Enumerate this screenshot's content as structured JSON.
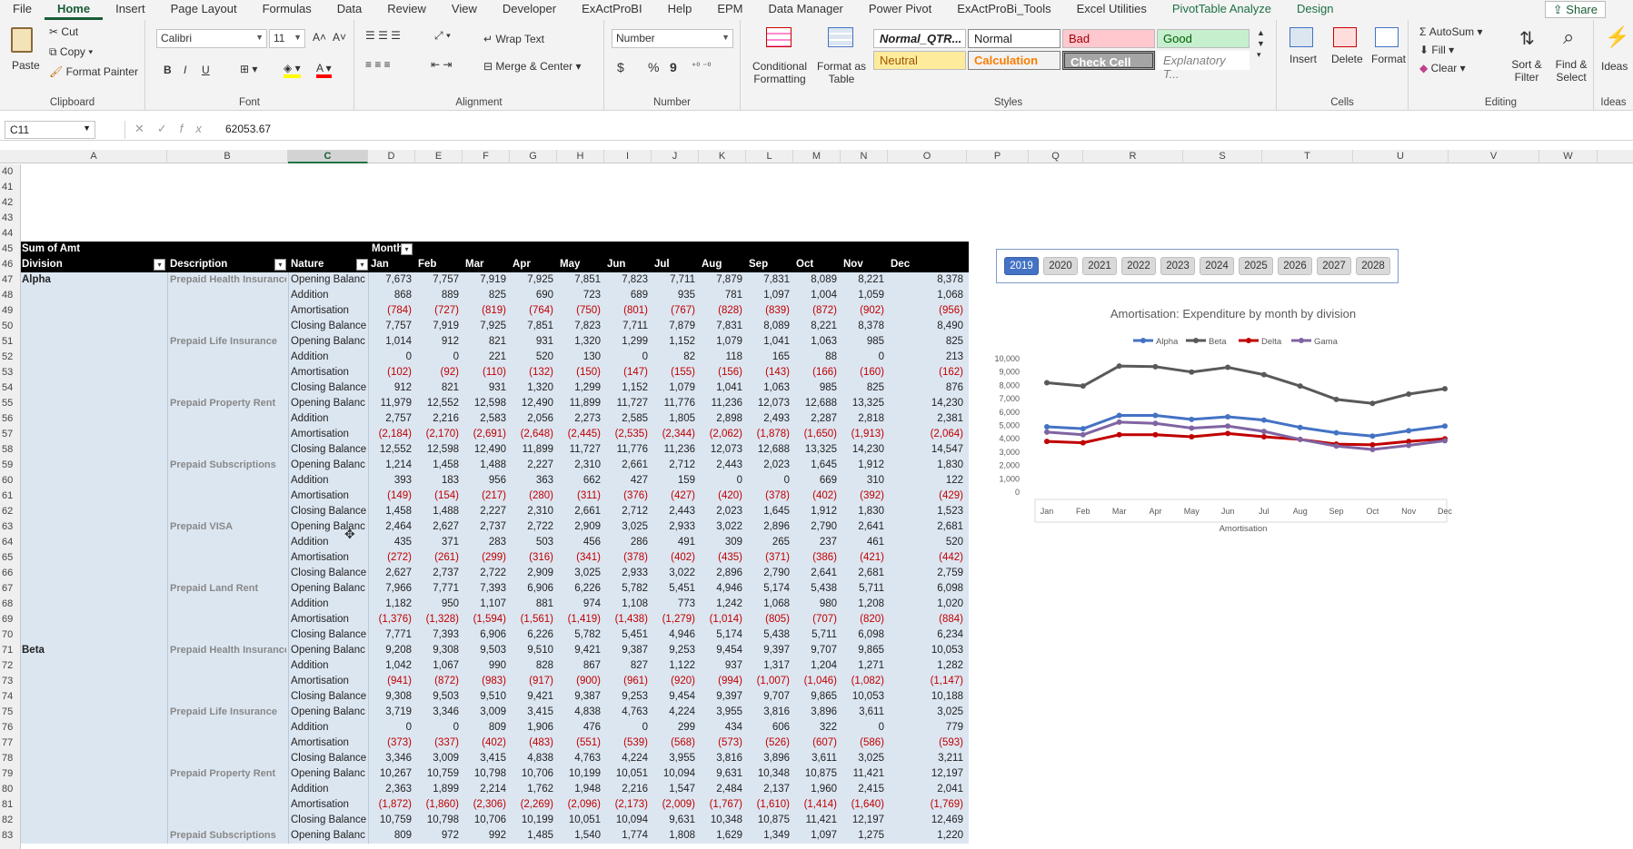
{
  "menu": {
    "items": [
      "File",
      "Home",
      "Insert",
      "Page Layout",
      "Formulas",
      "Data",
      "Review",
      "View",
      "Developer",
      "ExActProBI",
      "Help",
      "EPM",
      "Data Manager",
      "Power Pivot",
      "ExActProBi_Tools",
      "Excel Utilities",
      "PivotTable Analyze",
      "Design"
    ],
    "share": "Share"
  },
  "ribbon": {
    "clipboard": {
      "paste": "Paste",
      "cut": "Cut",
      "copy": "Copy",
      "format_painter": "Format Painter",
      "label": "Clipboard"
    },
    "font": {
      "name": "Calibri",
      "size": "11",
      "label": "Font",
      "bold": "B",
      "italic": "I",
      "underline": "U"
    },
    "alignment": {
      "wrap": "Wrap Text",
      "merge": "Merge & Center",
      "label": "Alignment"
    },
    "number": {
      "format": "Number",
      "label": "Number",
      "currency": "$",
      "percent": "%",
      "comma": "9"
    },
    "styles": {
      "cond": "Conditional Formatting",
      "table": "Format as Table",
      "label": "Styles",
      "normal_qtr": "Normal_QTR...",
      "normal": "Normal",
      "bad": "Bad",
      "good": "Good",
      "neutral": "Neutral",
      "calculation": "Calculation",
      "check_cell": "Check Cell",
      "explanatory": "Explanatory T..."
    },
    "cells": {
      "insert": "Insert",
      "delete": "Delete",
      "format": "Format",
      "label": "Cells"
    },
    "editing": {
      "autosum": "AutoSum",
      "fill": "Fill",
      "clear": "Clear",
      "sort": "Sort & Filter",
      "find": "Find & Select",
      "label": "Editing"
    },
    "ideas": {
      "ideas": "Ideas",
      "label": "Ideas"
    }
  },
  "formula_bar": {
    "name_box": "C11",
    "value": "62053.67",
    "fx": "fx"
  },
  "columns": [
    "A",
    "B",
    "C",
    "D",
    "E",
    "F",
    "G",
    "H",
    "I",
    "J",
    "K",
    "L",
    "M",
    "N",
    "O",
    "P",
    "Q",
    "R",
    "S",
    "T",
    "U",
    "V",
    "W"
  ],
  "selected_column": "C",
  "row_numbers": [
    40,
    41,
    42,
    43,
    44,
    45,
    46,
    47,
    48,
    49,
    50,
    51,
    52,
    53,
    54,
    55,
    56,
    57,
    58,
    59,
    60,
    61,
    62,
    63,
    64,
    65,
    66,
    67,
    68,
    69,
    70,
    71,
    72,
    73,
    74,
    75,
    76,
    77,
    78,
    79,
    80,
    81,
    82,
    83
  ],
  "pivot": {
    "header1": {
      "sum": "Sum of Amt",
      "month": "Month"
    },
    "header2": {
      "division": "Division",
      "description": "Description",
      "nature": "Nature",
      "months": [
        "Jan",
        "Feb",
        "Mar",
        "Apr",
        "May",
        "Jun",
        "Jul",
        "Aug",
        "Sep",
        "Oct",
        "Nov",
        "Dec"
      ]
    },
    "rows": [
      {
        "div": "Alpha",
        "desc": "Prepaid Health Insurance",
        "nat": "Opening Balanc",
        "v": [
          "7,673",
          "7,757",
          "7,919",
          "7,925",
          "7,851",
          "7,823",
          "7,711",
          "7,879",
          "7,831",
          "8,089",
          "8,221",
          "8,378"
        ]
      },
      {
        "div": "",
        "desc": "",
        "nat": "Addition",
        "v": [
          "868",
          "889",
          "825",
          "690",
          "723",
          "689",
          "935",
          "781",
          "1,097",
          "1,004",
          "1,059",
          "1,068"
        ]
      },
      {
        "div": "",
        "desc": "",
        "nat": "Amortisation",
        "v": [
          "(784)",
          "(727)",
          "(819)",
          "(764)",
          "(750)",
          "(801)",
          "(767)",
          "(828)",
          "(839)",
          "(872)",
          "(902)",
          "(956)"
        ]
      },
      {
        "div": "",
        "desc": "",
        "nat": "Closing Balance",
        "v": [
          "7,757",
          "7,919",
          "7,925",
          "7,851",
          "7,823",
          "7,711",
          "7,879",
          "7,831",
          "8,089",
          "8,221",
          "8,378",
          "8,490"
        ]
      },
      {
        "div": "",
        "desc": "Prepaid Life Insurance",
        "nat": "Opening Balanc",
        "v": [
          "1,014",
          "912",
          "821",
          "931",
          "1,320",
          "1,299",
          "1,152",
          "1,079",
          "1,041",
          "1,063",
          "985",
          "825"
        ]
      },
      {
        "div": "",
        "desc": "",
        "nat": "Addition",
        "v": [
          "0",
          "0",
          "221",
          "520",
          "130",
          "0",
          "82",
          "118",
          "165",
          "88",
          "0",
          "213"
        ]
      },
      {
        "div": "",
        "desc": "",
        "nat": "Amortisation",
        "v": [
          "(102)",
          "(92)",
          "(110)",
          "(132)",
          "(150)",
          "(147)",
          "(155)",
          "(156)",
          "(143)",
          "(166)",
          "(160)",
          "(162)"
        ]
      },
      {
        "div": "",
        "desc": "",
        "nat": "Closing Balance",
        "v": [
          "912",
          "821",
          "931",
          "1,320",
          "1,299",
          "1,152",
          "1,079",
          "1,041",
          "1,063",
          "985",
          "825",
          "876"
        ]
      },
      {
        "div": "",
        "desc": "Prepaid Property Rent",
        "nat": "Opening Balanc",
        "v": [
          "11,979",
          "12,552",
          "12,598",
          "12,490",
          "11,899",
          "11,727",
          "11,776",
          "11,236",
          "12,073",
          "12,688",
          "13,325",
          "14,230"
        ]
      },
      {
        "div": "",
        "desc": "",
        "nat": "Addition",
        "v": [
          "2,757",
          "2,216",
          "2,583",
          "2,056",
          "2,273",
          "2,585",
          "1,805",
          "2,898",
          "2,493",
          "2,287",
          "2,818",
          "2,381"
        ]
      },
      {
        "div": "",
        "desc": "",
        "nat": "Amortisation",
        "v": [
          "(2,184)",
          "(2,170)",
          "(2,691)",
          "(2,648)",
          "(2,445)",
          "(2,535)",
          "(2,344)",
          "(2,062)",
          "(1,878)",
          "(1,650)",
          "(1,913)",
          "(2,064)"
        ]
      },
      {
        "div": "",
        "desc": "",
        "nat": "Closing Balance",
        "v": [
          "12,552",
          "12,598",
          "12,490",
          "11,899",
          "11,727",
          "11,776",
          "11,236",
          "12,073",
          "12,688",
          "13,325",
          "14,230",
          "14,547"
        ]
      },
      {
        "div": "",
        "desc": "Prepaid Subscriptions",
        "nat": "Opening Balanc",
        "v": [
          "1,214",
          "1,458",
          "1,488",
          "2,227",
          "2,310",
          "2,661",
          "2,712",
          "2,443",
          "2,023",
          "1,645",
          "1,912",
          "1,830"
        ]
      },
      {
        "div": "",
        "desc": "",
        "nat": "Addition",
        "v": [
          "393",
          "183",
          "956",
          "363",
          "662",
          "427",
          "159",
          "0",
          "0",
          "669",
          "310",
          "122"
        ]
      },
      {
        "div": "",
        "desc": "",
        "nat": "Amortisation",
        "v": [
          "(149)",
          "(154)",
          "(217)",
          "(280)",
          "(311)",
          "(376)",
          "(427)",
          "(420)",
          "(378)",
          "(402)",
          "(392)",
          "(429)"
        ]
      },
      {
        "div": "",
        "desc": "",
        "nat": "Closing Balance",
        "v": [
          "1,458",
          "1,488",
          "2,227",
          "2,310",
          "2,661",
          "2,712",
          "2,443",
          "2,023",
          "1,645",
          "1,912",
          "1,830",
          "1,523"
        ]
      },
      {
        "div": "",
        "desc": "Prepaid VISA",
        "nat": "Opening Balanc",
        "v": [
          "2,464",
          "2,627",
          "2,737",
          "2,722",
          "2,909",
          "3,025",
          "2,933",
          "3,022",
          "2,896",
          "2,790",
          "2,641",
          "2,681"
        ]
      },
      {
        "div": "",
        "desc": "",
        "nat": "Addition",
        "v": [
          "435",
          "371",
          "283",
          "503",
          "456",
          "286",
          "491",
          "309",
          "265",
          "237",
          "461",
          "520"
        ]
      },
      {
        "div": "",
        "desc": "",
        "nat": "Amortisation",
        "v": [
          "(272)",
          "(261)",
          "(299)",
          "(316)",
          "(341)",
          "(378)",
          "(402)",
          "(435)",
          "(371)",
          "(386)",
          "(421)",
          "(442)"
        ]
      },
      {
        "div": "",
        "desc": "",
        "nat": "Closing Balance",
        "v": [
          "2,627",
          "2,737",
          "2,722",
          "2,909",
          "3,025",
          "2,933",
          "3,022",
          "2,896",
          "2,790",
          "2,641",
          "2,681",
          "2,759"
        ]
      },
      {
        "div": "",
        "desc": "Prepaid Land Rent",
        "nat": "Opening Balanc",
        "v": [
          "7,966",
          "7,771",
          "7,393",
          "6,906",
          "6,226",
          "5,782",
          "5,451",
          "4,946",
          "5,174",
          "5,438",
          "5,711",
          "6,098"
        ]
      },
      {
        "div": "",
        "desc": "",
        "nat": "Addition",
        "v": [
          "1,182",
          "950",
          "1,107",
          "881",
          "974",
          "1,108",
          "773",
          "1,242",
          "1,068",
          "980",
          "1,208",
          "1,020"
        ]
      },
      {
        "div": "",
        "desc": "",
        "nat": "Amortisation",
        "v": [
          "(1,376)",
          "(1,328)",
          "(1,594)",
          "(1,561)",
          "(1,419)",
          "(1,438)",
          "(1,279)",
          "(1,014)",
          "(805)",
          "(707)",
          "(820)",
          "(884)"
        ]
      },
      {
        "div": "",
        "desc": "",
        "nat": "Closing Balance",
        "v": [
          "7,771",
          "7,393",
          "6,906",
          "6,226",
          "5,782",
          "5,451",
          "4,946",
          "5,174",
          "5,438",
          "5,711",
          "6,098",
          "6,234"
        ]
      },
      {
        "div": "Beta",
        "desc": "Prepaid Health Insurance",
        "nat": "Opening Balanc",
        "v": [
          "9,208",
          "9,308",
          "9,503",
          "9,510",
          "9,421",
          "9,387",
          "9,253",
          "9,454",
          "9,397",
          "9,707",
          "9,865",
          "10,053"
        ]
      },
      {
        "div": "",
        "desc": "",
        "nat": "Addition",
        "v": [
          "1,042",
          "1,067",
          "990",
          "828",
          "867",
          "827",
          "1,122",
          "937",
          "1,317",
          "1,204",
          "1,271",
          "1,282"
        ]
      },
      {
        "div": "",
        "desc": "",
        "nat": "Amortisation",
        "v": [
          "(941)",
          "(872)",
          "(983)",
          "(917)",
          "(900)",
          "(961)",
          "(920)",
          "(994)",
          "(1,007)",
          "(1,046)",
          "(1,082)",
          "(1,147)"
        ]
      },
      {
        "div": "",
        "desc": "",
        "nat": "Closing Balance",
        "v": [
          "9,308",
          "9,503",
          "9,510",
          "9,421",
          "9,387",
          "9,253",
          "9,454",
          "9,397",
          "9,707",
          "9,865",
          "10,053",
          "10,188"
        ]
      },
      {
        "div": "",
        "desc": "Prepaid Life Insurance",
        "nat": "Opening Balanc",
        "v": [
          "3,719",
          "3,346",
          "3,009",
          "3,415",
          "4,838",
          "4,763",
          "4,224",
          "3,955",
          "3,816",
          "3,896",
          "3,611",
          "3,025"
        ]
      },
      {
        "div": "",
        "desc": "",
        "nat": "Addition",
        "v": [
          "0",
          "0",
          "809",
          "1,906",
          "476",
          "0",
          "299",
          "434",
          "606",
          "322",
          "0",
          "779"
        ]
      },
      {
        "div": "",
        "desc": "",
        "nat": "Amortisation",
        "v": [
          "(373)",
          "(337)",
          "(402)",
          "(483)",
          "(551)",
          "(539)",
          "(568)",
          "(573)",
          "(526)",
          "(607)",
          "(586)",
          "(593)"
        ]
      },
      {
        "div": "",
        "desc": "",
        "nat": "Closing Balance",
        "v": [
          "3,346",
          "3,009",
          "3,415",
          "4,838",
          "4,763",
          "4,224",
          "3,955",
          "3,816",
          "3,896",
          "3,611",
          "3,025",
          "3,211"
        ]
      },
      {
        "div": "",
        "desc": "Prepaid Property Rent",
        "nat": "Opening Balanc",
        "v": [
          "10,267",
          "10,759",
          "10,798",
          "10,706",
          "10,199",
          "10,051",
          "10,094",
          "9,631",
          "10,348",
          "10,875",
          "11,421",
          "12,197"
        ]
      },
      {
        "div": "",
        "desc": "",
        "nat": "Addition",
        "v": [
          "2,363",
          "1,899",
          "2,214",
          "1,762",
          "1,948",
          "2,216",
          "1,547",
          "2,484",
          "2,137",
          "1,960",
          "2,415",
          "2,041"
        ]
      },
      {
        "div": "",
        "desc": "",
        "nat": "Amortisation",
        "v": [
          "(1,872)",
          "(1,860)",
          "(2,306)",
          "(2,269)",
          "(2,096)",
          "(2,173)",
          "(2,009)",
          "(1,767)",
          "(1,610)",
          "(1,414)",
          "(1,640)",
          "(1,769)"
        ]
      },
      {
        "div": "",
        "desc": "",
        "nat": "Closing Balance",
        "v": [
          "10,759",
          "10,798",
          "10,706",
          "10,199",
          "10,051",
          "10,094",
          "9,631",
          "10,348",
          "10,875",
          "11,421",
          "12,197",
          "12,469"
        ]
      },
      {
        "div": "",
        "desc": "Prepaid Subscriptions",
        "nat": "Opening Balanc",
        "v": [
          "809",
          "972",
          "992",
          "1,485",
          "1,540",
          "1,774",
          "1,808",
          "1,629",
          "1,349",
          "1,097",
          "1,275",
          "1,220"
        ]
      }
    ]
  },
  "slicer": {
    "years": [
      "2019",
      "2020",
      "2021",
      "2022",
      "2023",
      "2024",
      "2025",
      "2026",
      "2027",
      "2028"
    ],
    "selected": "2019"
  },
  "chart_data": {
    "type": "line",
    "title": "Amortisation: Expenditure by month by division",
    "xlabel": "Amortisation",
    "ylabel": "",
    "categories": [
      "Jan",
      "Feb",
      "Mar",
      "Apr",
      "May",
      "Jun",
      "Jul",
      "Aug",
      "Sep",
      "Oct",
      "Nov",
      "Dec"
    ],
    "ylim": [
      0,
      10000
    ],
    "yticks": [
      "0",
      "1,000",
      "2,000",
      "3,000",
      "4,000",
      "5,000",
      "6,000",
      "7,000",
      "8,000",
      "9,000",
      "10,000"
    ],
    "legend": "top",
    "grid": false,
    "series": [
      {
        "name": "Alpha",
        "color": "#4472c4",
        "values": [
          4900,
          4750,
          5750,
          5750,
          5450,
          5650,
          5400,
          4850,
          4450,
          4200,
          4600,
          4950
        ]
      },
      {
        "name": "Beta",
        "color": "#595959",
        "values": [
          8200,
          7950,
          9450,
          9400,
          9000,
          9350,
          8800,
          7950,
          6950,
          6650,
          7350,
          7750
        ]
      },
      {
        "name": "Delta",
        "color": "#c00000",
        "values": [
          3800,
          3700,
          4300,
          4300,
          4150,
          4400,
          4150,
          3950,
          3600,
          3550,
          3800,
          4000
        ]
      },
      {
        "name": "Gama",
        "color": "#8064a2",
        "values": [
          4500,
          4300,
          5250,
          5150,
          4800,
          4950,
          4550,
          3950,
          3450,
          3200,
          3500,
          3850
        ]
      }
    ]
  }
}
